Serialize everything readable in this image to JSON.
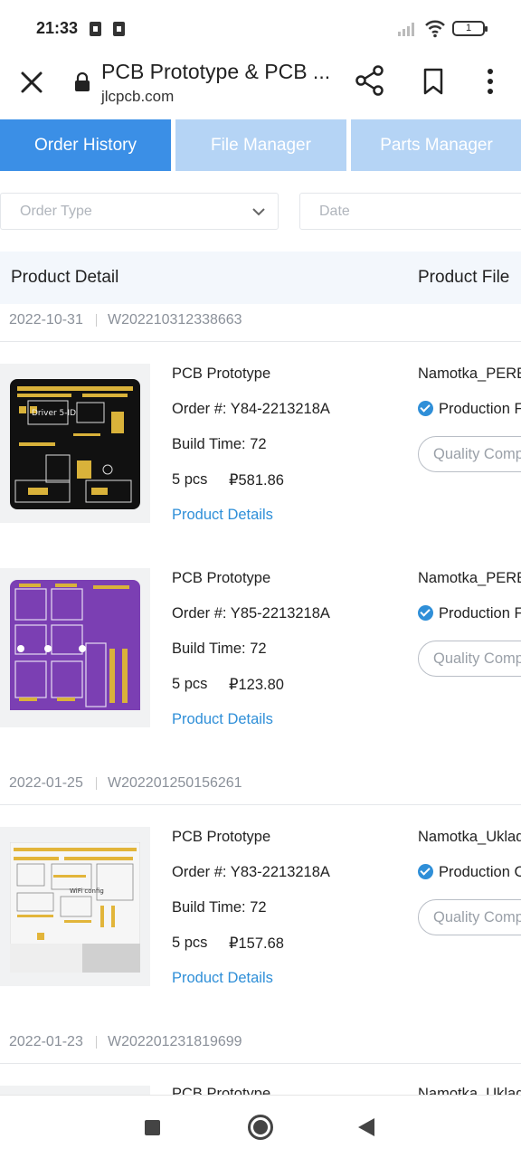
{
  "status_bar": {
    "time": "21:33",
    "battery_level": "1",
    "icons": [
      "notification-icon",
      "notification-icon",
      "signal-icon",
      "wifi-icon",
      "battery-icon"
    ]
  },
  "browser": {
    "page_title": "PCB Prototype & PCB ...",
    "url": "jlcpcb.com",
    "icons": [
      "close-icon",
      "lock-icon",
      "share-icon",
      "bookmark-icon",
      "more-icon"
    ]
  },
  "tabs": [
    {
      "label": "Order History",
      "active": true
    },
    {
      "label": "File Manager",
      "active": false
    },
    {
      "label": "Parts Manager",
      "active": false
    }
  ],
  "filters": {
    "order_type_placeholder": "Order Type",
    "date_placeholder": "Date"
  },
  "table_header": {
    "product_detail": "Product Detail",
    "product_file": "Product File"
  },
  "orders": [
    {
      "date": "2022-10-31",
      "number": "W202210312338663",
      "items": [
        {
          "type": "PCB Prototype",
          "order_no": "Order #: Y84-2213218A",
          "build_time": "Build Time: 72",
          "qty": "5 pcs",
          "price": "₽581.86",
          "details_link": "Product Details",
          "file_name": "Namotka_PERE",
          "production": "Production F",
          "quality": "Quality Comp",
          "board_color": "#111111"
        },
        {
          "type": "PCB Prototype",
          "order_no": "Order #: Y85-2213218A",
          "build_time": "Build Time: 72",
          "qty": "5 pcs",
          "price": "₽123.80",
          "details_link": "Product Details",
          "file_name": "Namotka_PERE",
          "production": "Production F",
          "quality": "Quality Comp",
          "board_color": "#7b3fb3"
        }
      ]
    },
    {
      "date": "2022-01-25",
      "number": "W202201250156261",
      "items": [
        {
          "type": "PCB Prototype",
          "order_no": "Order #: Y83-2213218A",
          "build_time": "Build Time: 72",
          "qty": "5 pcs",
          "price": "₽157.68",
          "details_link": "Product Details",
          "file_name": "Namotka_Uklad",
          "production": "Production C",
          "quality": "Quality Comp",
          "board_color": "#f4f4f4"
        }
      ]
    },
    {
      "date": "2022-01-23",
      "number": "W202201231819699",
      "items": [
        {
          "type": "PCB Prototype",
          "file_name": "Namotka_Uklad"
        }
      ]
    }
  ],
  "colors": {
    "accent": "#3b8fe6",
    "inactive_tab": "#b5d4f5",
    "link": "#2f8fd8"
  }
}
